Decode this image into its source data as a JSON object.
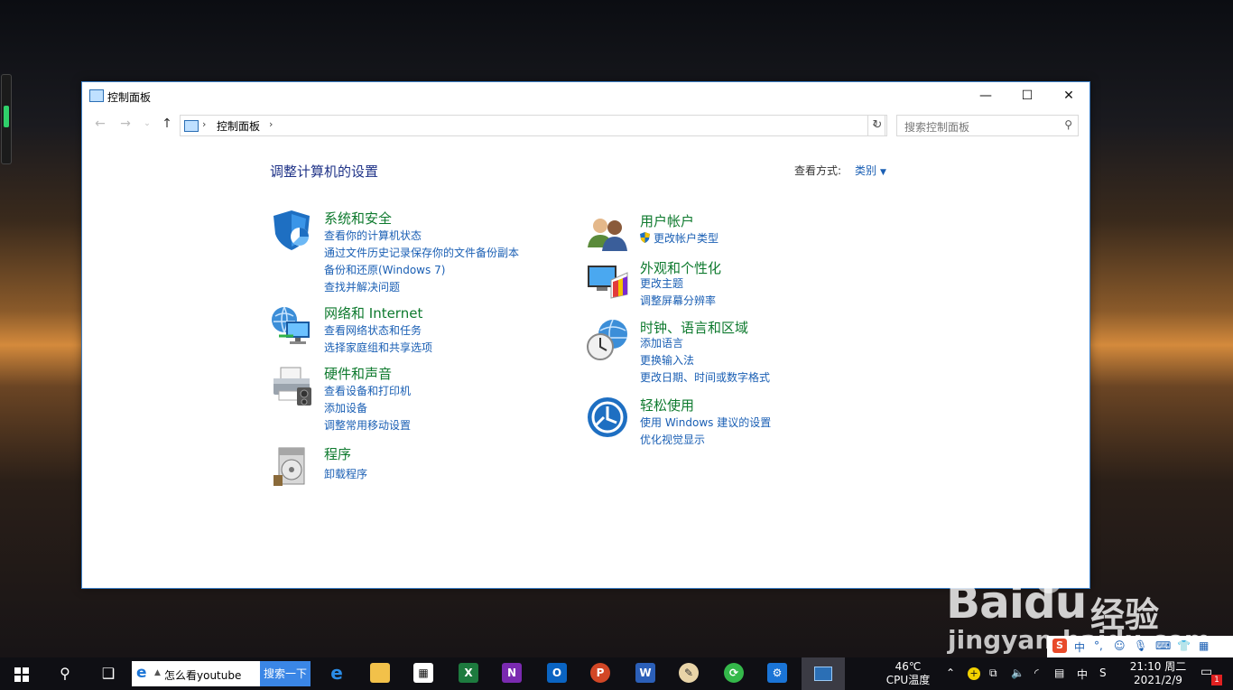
{
  "window": {
    "title": "控制面板",
    "breadcrumb": "控制面板",
    "search_placeholder": "搜索控制面板",
    "heading": "调整计算机的设置",
    "view_by_label": "查看方式:",
    "view_by_value": "类别"
  },
  "categories_left": [
    {
      "title": "系统和安全",
      "icon": "shield-icon",
      "links": [
        "查看你的计算机状态",
        "通过文件历史记录保存你的文件备份副本",
        "备份和还原(Windows 7)",
        "查找并解决问题"
      ]
    },
    {
      "title": "网络和 Internet",
      "icon": "network-globe-icon",
      "links": [
        "查看网络状态和任务",
        "选择家庭组和共享选项"
      ]
    },
    {
      "title": "硬件和声音",
      "icon": "printer-icon",
      "links": [
        "查看设备和打印机",
        "添加设备",
        "调整常用移动设置"
      ]
    },
    {
      "title": "程序",
      "icon": "programs-disc-icon",
      "links": [
        "卸载程序"
      ]
    }
  ],
  "categories_right": [
    {
      "title": "用户帐户",
      "icon": "users-icon",
      "links": [
        "更改帐户类型"
      ]
    },
    {
      "title": "外观和个性化",
      "icon": "display-palette-icon",
      "links": [
        "更改主题",
        "调整屏幕分辨率"
      ]
    },
    {
      "title": "时钟、语言和区域",
      "icon": "clock-globe-icon",
      "links": [
        "添加语言",
        "更换输入法",
        "更改日期、时间或数字格式"
      ]
    },
    {
      "title": "轻松使用",
      "icon": "ease-of-access-icon",
      "links": [
        "使用 Windows 建议的设置",
        "优化视觉显示"
      ]
    }
  ],
  "taskbar": {
    "search_query": "怎么看youtube",
    "search_button": "搜索一下",
    "apps": [
      "edge-icon",
      "file-explorer-icon",
      "store-icon",
      "excel-icon",
      "onenote-icon",
      "outlook-icon",
      "powerpoint-icon",
      "word-icon",
      "paint-icon",
      "green-app-icon",
      "settings-icon",
      "control-panel-icon"
    ],
    "temp_value": "46℃",
    "temp_label": "CPU温度",
    "ime": "中",
    "time": "21:10 周二",
    "date": "2021/2/9",
    "notification_count": "1"
  },
  "watermark": {
    "brand": "Bai",
    "brand2": "du",
    "cn": "经验",
    "url": "jingyan.baidu.com"
  }
}
